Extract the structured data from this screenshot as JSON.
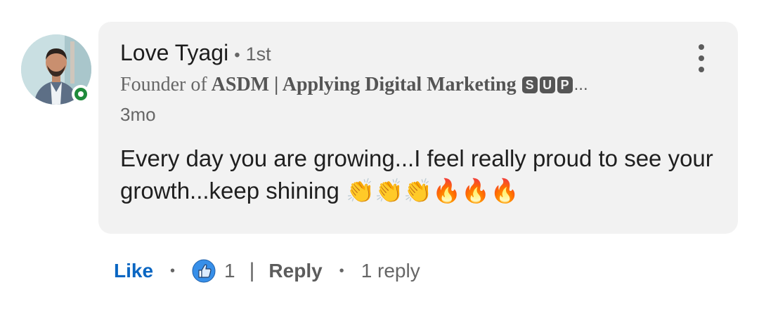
{
  "comment": {
    "author_name": "Love Tyagi",
    "connection_degree": "1st",
    "headline_light": "Founder of",
    "headline_bold": "ASDM | Applying Digital Marketing",
    "headline_boxed_letters": [
      "S",
      "U",
      "P"
    ],
    "headline_ellipsis": "...",
    "time_ago": "3mo",
    "text": "Every day you are growing...I feel really proud to see your growth...keep shining",
    "emojis": "👏👏👏🔥🔥🔥",
    "presence_status_color": "#1f8a3b",
    "icons": {
      "avatar": "profile-photo",
      "presence": "online-status-icon",
      "more": "more-options-vertical-icon"
    }
  },
  "actions": {
    "like_label": "Like",
    "separator_dot": "•",
    "reaction_icon": "thumbs-up-reaction-icon",
    "reaction_count": "1",
    "pipe": "|",
    "reply_label": "Reply",
    "replies_count_label": "1 reply",
    "like_color": "#0a66c2"
  }
}
